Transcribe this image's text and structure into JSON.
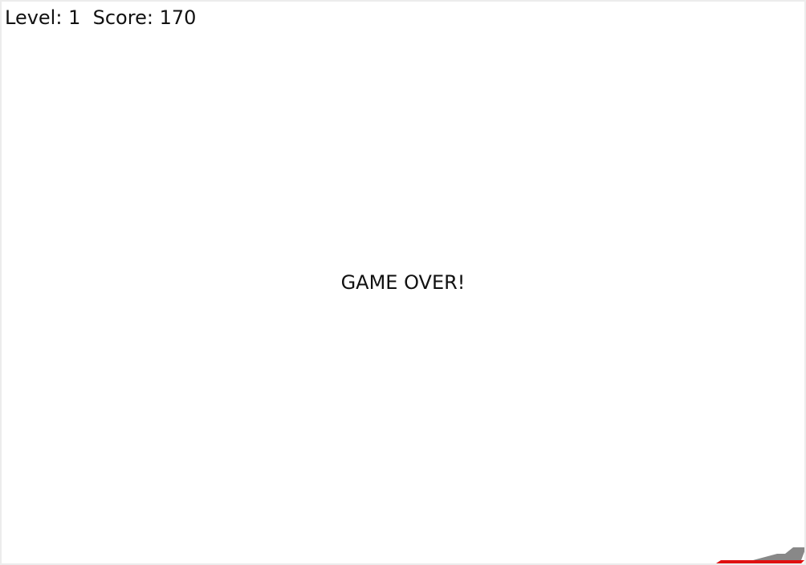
{
  "hud": {
    "level_label": "Level:",
    "level_value": "1",
    "score_label": "Score:",
    "score_value": "170"
  },
  "game_over_text": "GAME OVER!",
  "colors": {
    "ship_hull": "#888888",
    "ship_stripe": "#e01010",
    "text": "#111111",
    "background": "#ffffff"
  },
  "icons": {
    "player_ship": "player-ship-icon"
  }
}
